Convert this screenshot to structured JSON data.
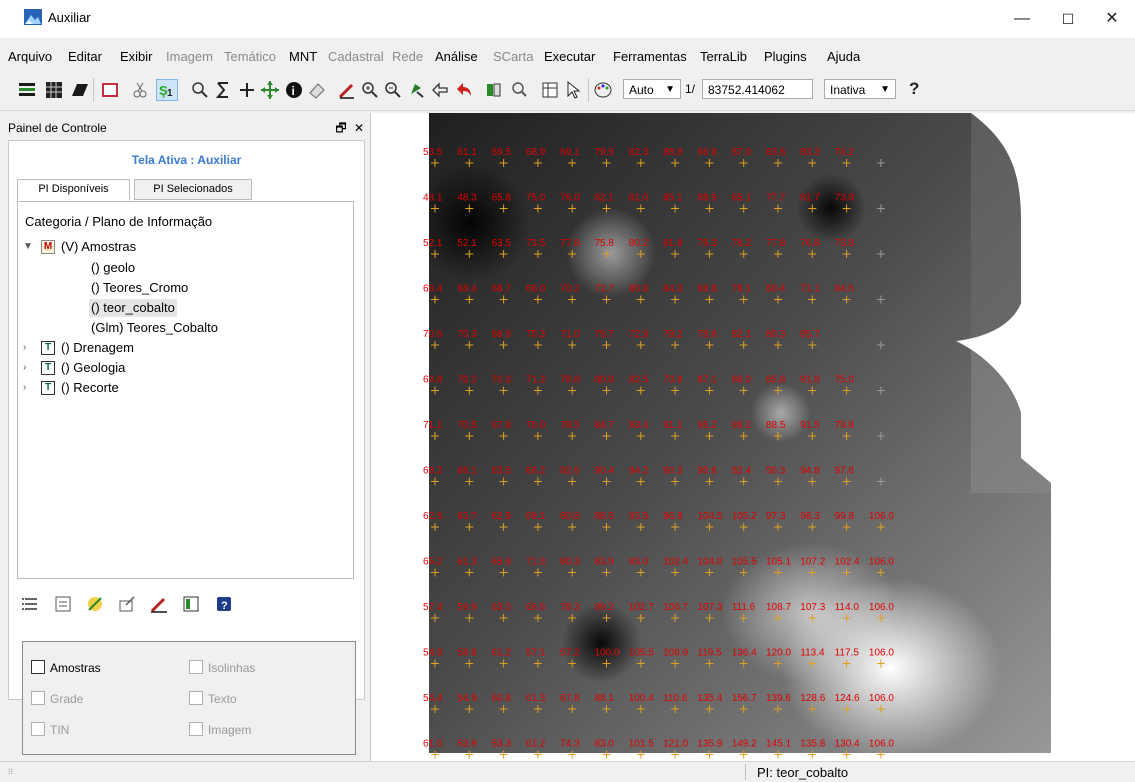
{
  "window": {
    "title": "Auxiliar",
    "minimize": "—",
    "maximize": "☐",
    "close": "✕"
  },
  "menu": [
    {
      "label": "Arquivo",
      "enabled": true
    },
    {
      "label": "Editar",
      "enabled": true
    },
    {
      "label": "Exibir",
      "enabled": true
    },
    {
      "label": "Imagem",
      "enabled": false
    },
    {
      "label": "Temático",
      "enabled": false
    },
    {
      "label": "MNT",
      "enabled": true
    },
    {
      "label": "Cadastral",
      "enabled": false
    },
    {
      "label": "Rede",
      "enabled": false
    },
    {
      "label": "Análise",
      "enabled": true
    },
    {
      "label": "SCarta",
      "enabled": false
    },
    {
      "label": "Executar",
      "enabled": true
    },
    {
      "label": "Ferramentas",
      "enabled": true
    },
    {
      "label": "TerraLib",
      "enabled": true
    },
    {
      "label": "Plugins",
      "enabled": true
    },
    {
      "label": "Ajuda",
      "enabled": true
    }
  ],
  "toolbar": {
    "scale_mode": "Auto",
    "scale_prefix": "1/",
    "scale_value": "83752.414062",
    "state": "Inativa",
    "help_glyph": "?"
  },
  "panel": {
    "title": "Painel de Controle",
    "float_glyph": "🗗",
    "close_glyph": "✕",
    "active_screen": "Tela Ativa : Auxiliar",
    "tabs": [
      "PI Disponíveis",
      "PI Selecionados"
    ],
    "tree_header": "Categoria / Plano de Informação",
    "tree": {
      "amostras": {
        "type": "M",
        "label": "(V) Amostras"
      },
      "children": [
        "() geolo",
        "() Teores_Cromo",
        "() teor_cobalto",
        "(Glm) Teores_Cobalto"
      ],
      "selected": "() teor_cobalto",
      "others": [
        {
          "type": "T",
          "label": "() Drenagem"
        },
        {
          "type": "T",
          "label": "() Geologia"
        },
        {
          "type": "T",
          "label": "() Recorte"
        }
      ]
    },
    "checkboxes": {
      "amostras": "Amostras",
      "isolinhas": "Isolinhas",
      "grade": "Grade",
      "texto": "Texto",
      "tin": "TIN",
      "imagem": "Imagem"
    }
  },
  "status": {
    "plane": "PI: teor_cobalto"
  },
  "map_labels": [
    [
      "53.5",
      "61.1",
      "69.5",
      "68.9",
      "69.1",
      "79.5",
      "82.3",
      "88.8",
      "96.9",
      "87.0",
      "83.6",
      "83.3",
      "74.2"
    ],
    [
      "48.1",
      "48.3",
      "65.8",
      "75.0",
      "76.0",
      "82.1",
      "81.0",
      "85.1",
      "88.9",
      "65.1",
      "77.7",
      "81.7",
      "73.8"
    ],
    [
      "52.1",
      "52.1",
      "63.5",
      "73.5",
      "77.8",
      "75.8",
      "80.2",
      "81.8",
      "79.3",
      "78.2",
      "77.8",
      "76.8",
      "73.8"
    ],
    [
      "68.4",
      "68.4",
      "68.7",
      "68.0",
      "70.2",
      "72.7",
      "80.8",
      "84.3",
      "68.8",
      "78.1",
      "80.4",
      "71.1",
      "84.6"
    ],
    [
      "70.6",
      "70.3",
      "68.9",
      "70.3",
      "71.0",
      "79.7",
      "72.9",
      "79.2",
      "78.6",
      "82.1",
      "80.3",
      "85.7"
    ],
    [
      "69.8",
      "70.2",
      "70.3",
      "71.2",
      "78.8",
      "80.8",
      "82.5",
      "73.8",
      "87.1",
      "86.0",
      "85.8",
      "91.8",
      "75.0"
    ],
    [
      "71.1",
      "70.5",
      "67.8",
      "70.0",
      "78.5",
      "84.7",
      "93.4",
      "91.1",
      "95.2",
      "89.2",
      "88.5",
      "91.5",
      "79.8"
    ],
    [
      "68.2",
      "66.1",
      "63.5",
      "66.2",
      "82.6",
      "90.4",
      "94.2",
      "90.3",
      "90.6",
      "82.4",
      "90.3",
      "94.8",
      "97.6"
    ],
    [
      "62.5",
      "63.7",
      "62.9",
      "69.1",
      "80.8",
      "88.5",
      "93.5",
      "96.8",
      "104.5",
      "105.2",
      "97.3",
      "98.3",
      "99.8",
      "106.0"
    ],
    [
      "65.2",
      "61.3",
      "65.9",
      "71.3",
      "80.3",
      "83.9",
      "93.0",
      "102.4",
      "104.0",
      "105.5",
      "105.1",
      "107.2",
      "102.4",
      "106.0"
    ],
    [
      "57.4",
      "59.9",
      "63.0",
      "66.6",
      "78.3",
      "89.2",
      "102.7",
      "106.7",
      "107.3",
      "111.6",
      "108.7",
      "107.3",
      "114.0",
      "106.0"
    ],
    [
      "54.9",
      "58.8",
      "61.2",
      "57.1",
      "57.2",
      "100.0",
      "105.5",
      "108.9",
      "119.5",
      "136.4",
      "120.0",
      "113.4",
      "117.5",
      "106.0"
    ],
    [
      "54.4",
      "54.9",
      "60.8",
      "61.3",
      "67.8",
      "88.1",
      "100.4",
      "110.6",
      "135.4",
      "156.7",
      "139.6",
      "128.6",
      "124.6",
      "106.0"
    ],
    [
      "61.0",
      "53.9",
      "53.3",
      "61.2",
      "74.3",
      "83.0",
      "101.5",
      "121.0",
      "135.9",
      "149.2",
      "145.1",
      "135.8",
      "130.4",
      "106.0"
    ]
  ]
}
